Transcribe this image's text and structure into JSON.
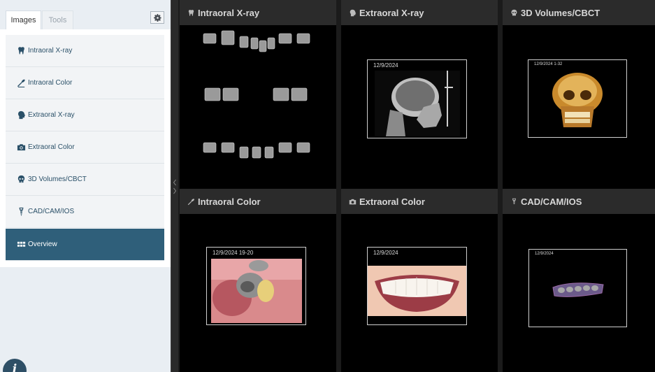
{
  "tabs": [
    {
      "label": "Images",
      "active": true
    },
    {
      "label": "Tools",
      "active": false
    }
  ],
  "menu": [
    {
      "label": "Intraoral X-ray",
      "icon": "tooth-icon"
    },
    {
      "label": "Intraoral Color",
      "icon": "dental-mirror-icon"
    },
    {
      "label": "Extraoral X-ray",
      "icon": "head-profile-icon"
    },
    {
      "label": "Extraoral Color",
      "icon": "camera-icon"
    },
    {
      "label": "3D Volumes/CBCT",
      "icon": "skull-icon"
    },
    {
      "label": "CAD/CAM/IOS",
      "icon": "implant-icon"
    },
    {
      "label": "Overview",
      "icon": "grid-icon",
      "active": true
    }
  ],
  "panels": [
    {
      "title": "Intraoral X-ray",
      "icon": "tooth-icon"
    },
    {
      "title": "Extraoral X-ray",
      "icon": "head-profile-icon",
      "date": "12/9/2024"
    },
    {
      "title": "3D Volumes/CBCT",
      "icon": "skull-icon",
      "date": "12/9/2024     1-32"
    },
    {
      "title": "Intraoral Color",
      "icon": "dental-mirror-icon",
      "date": "12/9/2024     19-20"
    },
    {
      "title": "Extraoral Color",
      "icon": "camera-icon",
      "date": "12/9/2024"
    },
    {
      "title": "CAD/CAM/IOS",
      "icon": "implant-icon",
      "date": "12/9/2024"
    }
  ],
  "colors": {
    "accent": "#2f5f7a",
    "sidebar_bg": "#e9eef3",
    "panel_header": "#2b2b2b",
    "menu_text": "#2a5068"
  }
}
